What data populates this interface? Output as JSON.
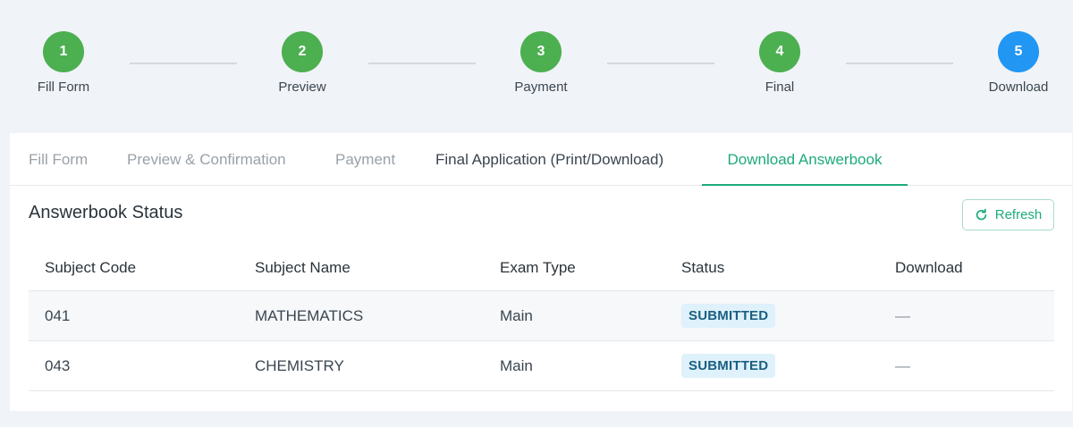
{
  "stepper": {
    "steps": [
      {
        "number": "1",
        "label": "Fill Form",
        "state": "done"
      },
      {
        "number": "2",
        "label": "Preview",
        "state": "done"
      },
      {
        "number": "3",
        "label": "Payment",
        "state": "done"
      },
      {
        "number": "4",
        "label": "Final",
        "state": "done"
      },
      {
        "number": "5",
        "label": "Download",
        "state": "active"
      }
    ]
  },
  "tabs": [
    {
      "label": "Fill Form"
    },
    {
      "label": "Preview & Confirmation"
    },
    {
      "label": "Payment"
    },
    {
      "label": "Final Application (Print/Download)"
    },
    {
      "label": "Download Answerbook"
    }
  ],
  "section": {
    "title": "Answerbook Status",
    "refresh_label": "Refresh",
    "refresh_icon": "refresh-icon"
  },
  "table": {
    "headers": [
      "Subject Code",
      "Subject Name",
      "Exam Type",
      "Status",
      "Download"
    ],
    "rows": [
      {
        "code": "041",
        "name": "MATHEMATICS",
        "exam_type": "Main",
        "status": "SUBMITTED",
        "download": "—"
      },
      {
        "code": "043",
        "name": "CHEMISTRY",
        "exam_type": "Main",
        "status": "SUBMITTED",
        "download": "—"
      }
    ]
  },
  "colors": {
    "step_done": "#4caf50",
    "step_active": "#2196f3",
    "accent": "#1eab78",
    "badge_bg": "#dff1fb",
    "badge_text": "#1a5f82"
  }
}
